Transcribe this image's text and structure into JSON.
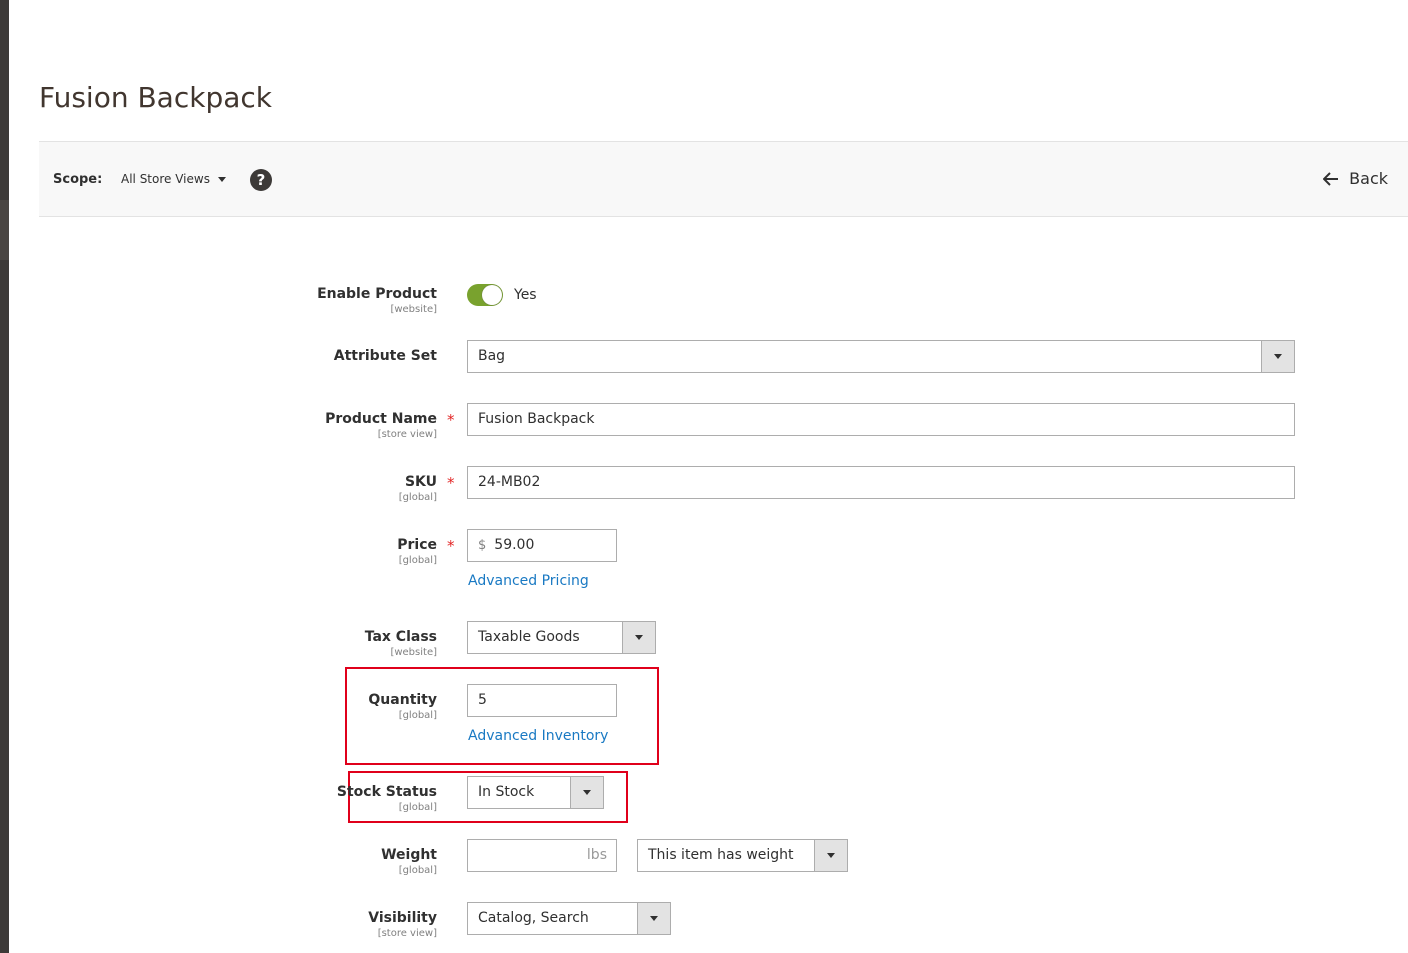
{
  "page": {
    "title": "Fusion Backpack"
  },
  "scope_bar": {
    "label": "Scope:",
    "switcher": "All Store Views",
    "back_label": "Back"
  },
  "fields": {
    "enable_product": {
      "label": "Enable Product",
      "scope": "[website]",
      "value": "Yes",
      "enabled": true
    },
    "attribute_set": {
      "label": "Attribute Set",
      "value": "Bag"
    },
    "product_name": {
      "label": "Product Name",
      "scope": "[store view]",
      "value": "Fusion Backpack",
      "required": "*"
    },
    "sku": {
      "label": "SKU",
      "scope": "[global]",
      "value": "24-MB02",
      "required": "*"
    },
    "price": {
      "label": "Price",
      "scope": "[global]",
      "currency": "$",
      "value": "59.00",
      "required": "*",
      "link": "Advanced Pricing"
    },
    "tax_class": {
      "label": "Tax Class",
      "scope": "[website]",
      "value": "Taxable Goods"
    },
    "quantity": {
      "label": "Quantity",
      "scope": "[global]",
      "value": "5",
      "link": "Advanced Inventory"
    },
    "stock_status": {
      "label": "Stock Status",
      "scope": "[global]",
      "value": "In Stock"
    },
    "weight": {
      "label": "Weight",
      "scope": "[global]",
      "value": "",
      "unit": "lbs",
      "type_value": "This item has weight"
    },
    "visibility": {
      "label": "Visibility",
      "scope": "[store view]",
      "value": "Catalog, Search"
    }
  },
  "colors": {
    "toggle_on": "#79a22e",
    "link": "#1979c3",
    "required": "#e22626",
    "highlight": "#e0001b"
  }
}
